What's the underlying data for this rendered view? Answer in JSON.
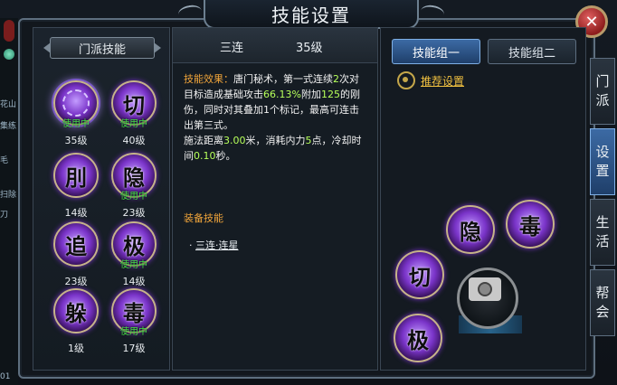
{
  "window": {
    "title": "技能设置",
    "close_label": "✕"
  },
  "left_panel": {
    "header": "门派技能",
    "skills": [
      {
        "glyph": "",
        "level": "35级",
        "in_use": "使用中",
        "selected": true
      },
      {
        "glyph": "切",
        "level": "40级",
        "in_use": "使用中"
      },
      {
        "glyph": "刖",
        "level": "14级",
        "in_use": ""
      },
      {
        "glyph": "隐",
        "level": "23级",
        "in_use": "使用中"
      },
      {
        "glyph": "追",
        "level": "23级",
        "in_use": ""
      },
      {
        "glyph": "极",
        "level": "14级",
        "in_use": "使用中"
      },
      {
        "glyph": "躲",
        "level": "1级",
        "in_use": ""
      },
      {
        "glyph": "毒",
        "level": "17级",
        "in_use": "使用中"
      }
    ]
  },
  "mid_panel": {
    "name": "三连",
    "level": "35级",
    "effect_label": "技能效果：",
    "effect_p1": "唐门秘术，第一式连续",
    "effect_num1": "2",
    "effect_p2": "次对目标造成基础攻击",
    "effect_num2": "66.13%",
    "effect_p3": "附加",
    "effect_num3": "125",
    "effect_p4": "的刚伤，同时对其叠加1个标记，最高可连击出第三式。",
    "range_p1": "施法距离",
    "range_val": "3.00",
    "range_p2": "米，消耗内力",
    "cost_val": "5",
    "range_p3": "点，冷却时间",
    "cd_val": "0.10",
    "range_p4": "秒。",
    "equip_title": "装备技能",
    "equip_bullet": "·",
    "equip_item": "三连·连星"
  },
  "right_panel": {
    "group1": "技能组一",
    "group2": "技能组二",
    "recommend": "推荐设置",
    "ring_glyphs": [
      "隐",
      "毒",
      "切",
      "极"
    ]
  },
  "side_tabs": [
    {
      "line1": "门",
      "line2": "派"
    },
    {
      "line1": "设",
      "line2": "置"
    },
    {
      "line1": "生",
      "line2": "活"
    },
    {
      "line1": "帮",
      "line2": "会"
    }
  ],
  "left_strip": {
    "texts": [
      "花山",
      "集练",
      "毛",
      "扫除",
      "刀",
      "01"
    ]
  }
}
